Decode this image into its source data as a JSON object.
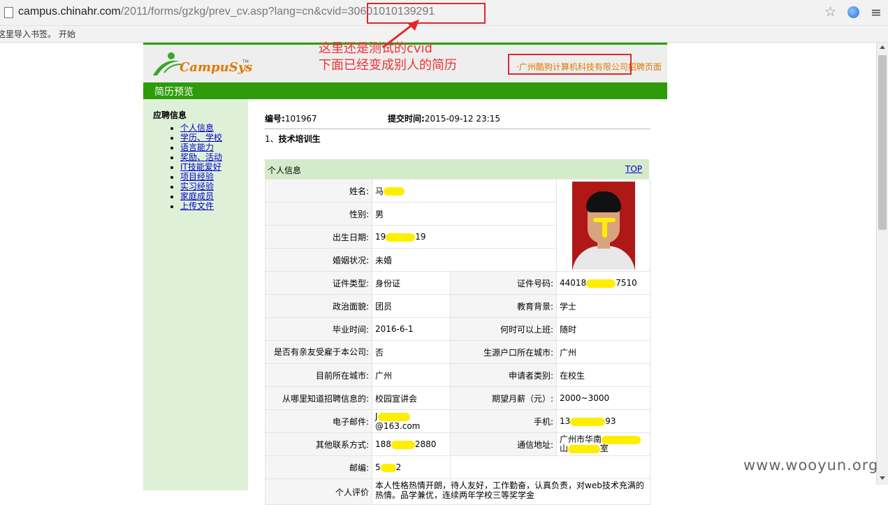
{
  "browser": {
    "url_host": "campus.chinahr.com",
    "url_path": "/2011/forms/gzkg/prev_cv.asp?lang=cn&",
    "url_param": "cvid=30601010139291",
    "bookmark_hint": "这里导入书签。",
    "bookmark_start": "开始"
  },
  "annotation": {
    "line1": "这里还是测试的cvid",
    "line2": "下面已经变成别人的简历",
    "color": "#ee3333"
  },
  "header": {
    "logo_text": "CampuSys",
    "logo_tm": "TM",
    "company": "广州酷狗计算机科技有限公司",
    "recruit_page": "招聘页面"
  },
  "navbar": {
    "title": "简历预览"
  },
  "sidebar": {
    "title": "应聘信息",
    "items": [
      {
        "label": "个人信息"
      },
      {
        "label": "学历、学校"
      },
      {
        "label": "语言能力"
      },
      {
        "label": "奖励、活动"
      },
      {
        "label": "IT技能爱好"
      },
      {
        "label": "项目经验"
      },
      {
        "label": "实习经验"
      },
      {
        "label": "家庭成员"
      },
      {
        "label": "上传文件"
      }
    ]
  },
  "main": {
    "id_label": "编号:",
    "id_value": "101967",
    "submit_label": "提交时间:",
    "submit_value": "2015-09-12 23:15",
    "job_index": "1、",
    "job_title": "技术培训生",
    "section_title": "个人信息",
    "top_link": "TOP"
  },
  "table": {
    "name_label": "姓名:",
    "name_val_pre": "马",
    "name_val_post": "",
    "gender_label": "性别:",
    "gender_val": "男",
    "birth_label": "出生日期:",
    "birth_pre": "19",
    "birth_post": "19",
    "marital_label": "婚姻状况:",
    "marital_val": "未婚",
    "idtype_label": "证件类型:",
    "idtype_val": "身份证",
    "idno_label": "证件号码:",
    "idno_pre": "44018",
    "idno_post": "7510",
    "political_label": "政治面貌:",
    "political_val": "团员",
    "edu_label": "教育背景:",
    "edu_val": "学士",
    "grad_label": "毕业时间:",
    "grad_val": "2016-6-1",
    "start_label": "何时可以上班:",
    "start_val": "随时",
    "relatives_label": "是否有亲友受雇于本公司:",
    "relatives_val": "否",
    "hukou_label": "生源户口所在城市:",
    "hukou_val": "广州",
    "city_label": "目前所在城市:",
    "city_val": "广州",
    "applicant_label": "申请者类别:",
    "applicant_val": "在校生",
    "source_label": "从哪里知道招聘信息的:",
    "source_val": "校园宣讲会",
    "salary_label": "期望月薪（元）:",
    "salary_val": "2000~3000",
    "email_label": "电子邮件:",
    "email_pre": "J",
    "email_post": "@163.com",
    "phone_label": "手机:",
    "phone_pre": "13",
    "phone_post": "93",
    "other_label": "其他联系方式:",
    "other_pre": "188",
    "other_post": "2880",
    "addr_label": "通信地址:",
    "addr_pre": "广州市华南",
    "addr_mid": "山",
    "addr_post": "室",
    "zip_label": "邮编:",
    "zip_pre": "5",
    "zip_post": "2",
    "eval_label": "个人评价",
    "eval_val": "本人性格热情开朗，待人友好，工作勤奋，认真负责，对web技术充满的热情。品学兼优，连续两年学校三等奖学金"
  },
  "watermark": "www.wooyun.org"
}
